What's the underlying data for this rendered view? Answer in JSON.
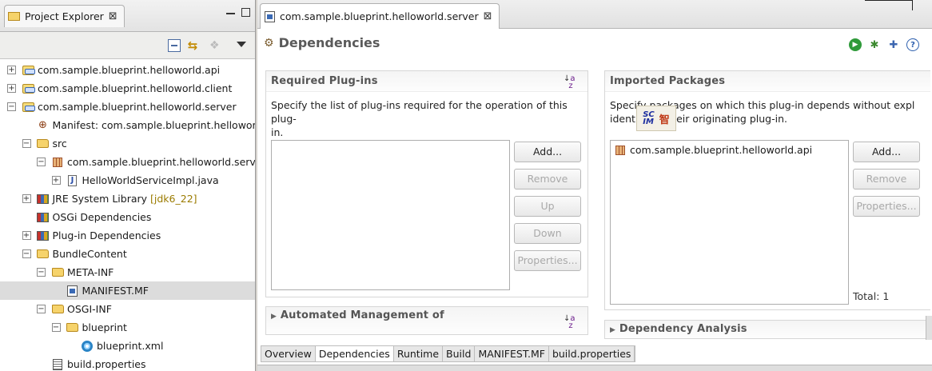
{
  "explorer": {
    "title": "Project Explorer",
    "items": [
      {
        "label": "com.sample.blueprint.helloworld.api",
        "toggle": "+",
        "icon": "project-icon"
      },
      {
        "label": "com.sample.blueprint.helloworld.client",
        "toggle": "+",
        "icon": "project-icon"
      },
      {
        "label": "com.sample.blueprint.helloworld.server",
        "toggle": "−",
        "icon": "project-icon"
      },
      {
        "label": "Manifest: com.sample.blueprint.helloworld",
        "toggle": "",
        "icon": "manifest-icon"
      },
      {
        "label": "src",
        "toggle": "−",
        "icon": "folder-icon"
      },
      {
        "label": "com.sample.blueprint.helloworld.server",
        "toggle": "−",
        "icon": "package-icon"
      },
      {
        "label": "HelloWorldServiceImpl.java",
        "toggle": "+",
        "icon": "java-file-icon"
      },
      {
        "label": "JRE System Library",
        "decoration": "[jdk6_22]",
        "toggle": "+",
        "icon": "library-icon"
      },
      {
        "label": "OSGi Dependencies",
        "toggle": "",
        "icon": "library-icon"
      },
      {
        "label": "Plug-in Dependencies",
        "toggle": "+",
        "icon": "library-icon"
      },
      {
        "label": "BundleContent",
        "toggle": "−",
        "icon": "folder-icon"
      },
      {
        "label": "META-INF",
        "toggle": "−",
        "icon": "folder-icon"
      },
      {
        "label": "MANIFEST.MF",
        "toggle": "",
        "icon": "manifest-file-icon"
      },
      {
        "label": "OSGI-INF",
        "toggle": "−",
        "icon": "folder-icon"
      },
      {
        "label": "blueprint",
        "toggle": "−",
        "icon": "folder-icon"
      },
      {
        "label": "blueprint.xml",
        "toggle": "",
        "icon": "blueprint-icon"
      },
      {
        "label": "build.properties",
        "toggle": "",
        "icon": "properties-file-icon"
      }
    ]
  },
  "editor": {
    "tab_label": "com.sample.blueprint.helloworld.server",
    "form_title": "Dependencies",
    "required_plugins": {
      "title": "Required Plug-ins",
      "description_line1": "Specify the list of plug-ins required for the operation of this plug-",
      "description_line2": "in.",
      "buttons": {
        "add": "Add...",
        "remove": "Remove",
        "up": "Up",
        "down": "Down",
        "properties": "Properties..."
      }
    },
    "imported_packages": {
      "title": "Imported Packages",
      "description_line1": "Specify packages on which this plug-in depends without expl",
      "description_line2": "identifying their originating plug-in.",
      "items": [
        "com.sample.blueprint.helloworld.api"
      ],
      "buttons": {
        "add": "Add...",
        "remove": "Remove",
        "properties": "Properties..."
      },
      "total": "Total: 1"
    },
    "automated_management": {
      "title": "Automated Management of"
    },
    "dependency_analysis": {
      "title": "Dependency Analysis"
    },
    "bottom_tabs": [
      "Overview",
      "Dependencies",
      "Runtime",
      "Build",
      "MANIFEST.MF",
      "build.properties"
    ],
    "active_bottom_tab": "Dependencies"
  },
  "ime": {
    "line1": "SC",
    "line2": "IM",
    "char": "智"
  },
  "colors": {
    "selection": "#dcdcdc",
    "section_title": "#555555",
    "disabled_text": "#a9a9a9"
  }
}
